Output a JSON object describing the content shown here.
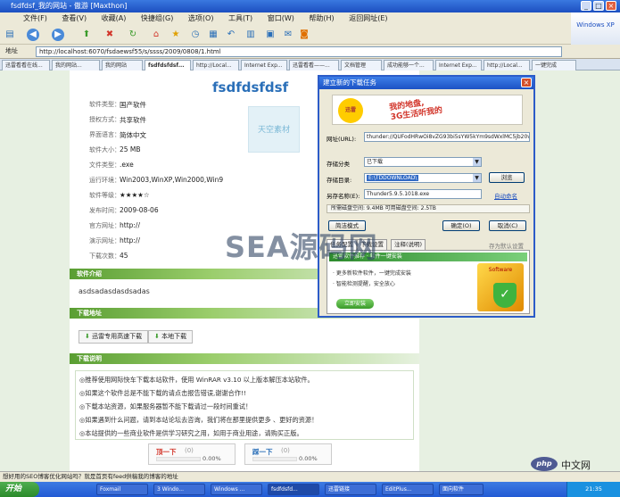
{
  "window": {
    "title": "fsdfdsf_我的网站 - 傲游 [Maxthon]"
  },
  "winbuttons": [
    "_",
    "□",
    "×"
  ],
  "menu": [
    "文件(F)",
    "查看(V)",
    "收藏(A)",
    "快捷组(G)",
    "选项(O)",
    "工具(T)",
    "窗口(W)",
    "帮助(H)",
    "返回网址(E)"
  ],
  "address": {
    "label": "地址",
    "url": "http://localhost:6070/fsdaewsf55/s/ssss/2009/0808/1.html"
  },
  "tabs": [
    "迅雷看看在线...",
    "我的网站...",
    "我的网站",
    "fsdfdsfdsf...",
    "http://Local...",
    "Internet Exp...",
    "迅雷看看——...",
    "文档管理",
    "成功能够一个...",
    "Internet Exp...",
    "http://Local...",
    "一键完成"
  ],
  "software": {
    "title": "fsdfdsfdsf",
    "fields": [
      {
        "label": "软件类型：",
        "value": "国产软件"
      },
      {
        "label": "授权方式：",
        "value": "共享软件"
      },
      {
        "label": "界面语言：",
        "value": "简体中文"
      },
      {
        "label": "软件大小：",
        "value": "25 MB"
      },
      {
        "label": "文件类型：",
        "value": ".exe"
      },
      {
        "label": "运行环境：",
        "value": "Win2003,WinXP,Win2000,Win9"
      },
      {
        "label": "软件等级：",
        "value": "★★★★☆"
      },
      {
        "label": "发布时间：",
        "value": "2009-08-06"
      },
      {
        "label": "官方网址：",
        "value": "http://"
      },
      {
        "label": "演示网址：",
        "value": "http://"
      },
      {
        "label": "下载次数：",
        "value": "45"
      }
    ],
    "thumb_text": "天空素材",
    "intro_header": "软件介绍",
    "intro_text": "asdsadasdasdsadas",
    "download_header": "下载地址",
    "download_buttons": [
      "迅雷专用高速下载",
      "本地下载"
    ],
    "notes_header": "下载说明",
    "notes": [
      "◎推荐使用网际快车下载本站软件，使用 WinRAR v3.10 以上版本解压本站软件。",
      "◎如果这个软件总是不能下载的请点击报告错误,谢谢合作!!",
      "◎下载本站资源，如果服务器暂不能下载请过一段时间重试！",
      "◎如果遇到什么问题，请到本站论坛去咨询，我们将在那里提供更多 、更好的资源！",
      "◎本站提供的一些商业软件是供学习研究之用，如用于商业用途，请购买正版。"
    ],
    "votes": [
      {
        "label": "顶一下",
        "count": "(0)",
        "percent": "0.00%"
      },
      {
        "label": "踩一下",
        "count": "(0)",
        "percent": "0.00%"
      }
    ]
  },
  "dialog": {
    "title": "建立新的下载任务",
    "close": "×",
    "banner_logo": "迅雷",
    "banner_line1": "我的地盘,",
    "banner_line2": "3G生活听我的",
    "url_label": "网址(URL):",
    "url_value": "thunder://QUFodHRwOi8vZG93bi5sYW5kYm9sdWxlMC5jb20vZGF2ZXI1",
    "category_label": "存储分类",
    "category_value": "已下载",
    "dir_label": "存储目录:",
    "dir_value": "E:\\TDDOWNLOAD\\",
    "browse": "浏览",
    "saveas_label": "另存名称(E):",
    "saveas_value": "Thunder5.9.5.1018.exe",
    "autoname": "自动命名",
    "space_info": "所需磁盘空间: 9.4MB          可用磁盘空间: 2.5TB",
    "simple_mode": "简洁模式",
    "ok": "确定(O)",
    "cancel": "取消(C)",
    "tabs": [
      "任务配置",
      "下载设置",
      "注释(说明)"
    ],
    "default_link": "存为默认设置",
    "promo_header": "迅雷软件推荐 · 软件一键安装",
    "promo_lines": [
      "· 更多新软件软件，一键完成安装",
      "· 智能检测提醒，安全放心"
    ],
    "promo_button": "立即安装",
    "softbox_label": "Software",
    "shield_icon": "✓"
  },
  "watermark": "SEA源码网",
  "status": {
    "text": "想好用的SEO博客优化网站吗？就是首页有feed供稿我的博客的地址"
  },
  "taskbar": {
    "start": "开始",
    "items": [
      "Foxmail",
      "3 Windo...",
      "Windows ...",
      "fsdfdsfd...",
      "迅雷链接",
      "EditPlus...",
      "面向软件"
    ],
    "tray_time": "21:35"
  },
  "brand": {
    "php": "php",
    "php_cn": "中文网"
  },
  "colors": {
    "title_blue": "#2a6fb8",
    "section_green": "#5a9e33",
    "dialog_border": "#2c5cc8"
  }
}
